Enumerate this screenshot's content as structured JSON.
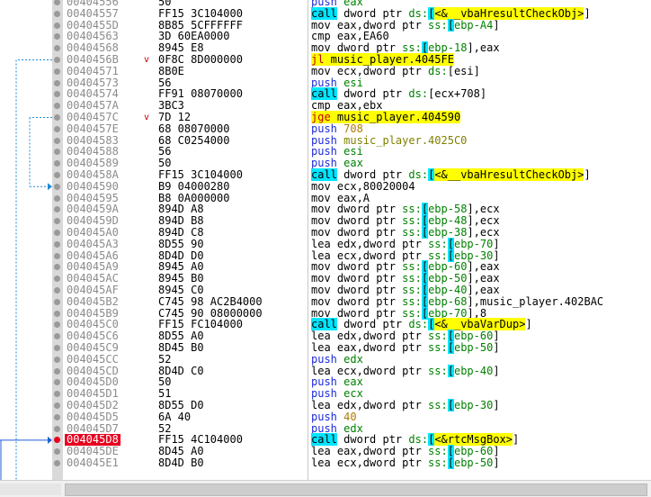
{
  "rows": [
    {
      "addr": "00404556",
      "bytes": "50",
      "marker": "",
      "parts": [
        [
          "push",
          "mn-push"
        ],
        [
          " eax",
          "reg"
        ]
      ]
    },
    {
      "addr": "00404557",
      "bytes": "FF15 3C104000",
      "marker": "",
      "parts": [
        [
          "call",
          "mn-call"
        ],
        [
          " dword ptr ",
          "kw"
        ],
        [
          "ds:",
          "seg"
        ],
        [
          "[",
          "br"
        ],
        [
          "<&__vbaHresultCheckObj>",
          "op-call"
        ],
        [
          "]",
          "kw"
        ]
      ]
    },
    {
      "addr": "0040455D",
      "bytes": "8B85 5CFFFFFF",
      "marker": "",
      "parts": [
        [
          "mov eax,dword ptr ",
          "kw"
        ],
        [
          "ss:",
          "seg"
        ],
        [
          "[",
          "br"
        ],
        [
          "ebp-A4",
          "off"
        ],
        [
          "]",
          "kw"
        ]
      ]
    },
    {
      "addr": "00404563",
      "bytes": "3D 60EA0000",
      "marker": "",
      "parts": [
        [
          "cmp eax,EA60",
          "kw"
        ]
      ]
    },
    {
      "addr": "00404568",
      "bytes": "8945 E8",
      "marker": "",
      "parts": [
        [
          "mov dword ptr ",
          "kw"
        ],
        [
          "ss:",
          "seg"
        ],
        [
          "[",
          "br"
        ],
        [
          "ebp-18",
          "off"
        ],
        [
          "],eax",
          "kw"
        ]
      ]
    },
    {
      "addr": "0040456B",
      "bytes": "0F8C 8D000000",
      "marker": "v",
      "parts": [
        [
          "jl",
          "mn-jmp"
        ],
        [
          " music_player.4045FE",
          "op-jmp"
        ]
      ]
    },
    {
      "addr": "00404571",
      "bytes": "8B0E",
      "marker": "",
      "parts": [
        [
          "mov ecx,dword ptr ",
          "kw"
        ],
        [
          "ds:",
          "seg"
        ],
        [
          "[esi]",
          "kw"
        ]
      ]
    },
    {
      "addr": "00404573",
      "bytes": "56",
      "marker": "",
      "parts": [
        [
          "push",
          "mn-push"
        ],
        [
          " esi",
          "reg"
        ]
      ]
    },
    {
      "addr": "00404574",
      "bytes": "FF91 08070000",
      "marker": "",
      "parts": [
        [
          "call",
          "mn-call"
        ],
        [
          " dword ptr ",
          "kw"
        ],
        [
          "ds:",
          "seg"
        ],
        [
          "[ecx+708]",
          "kw"
        ]
      ]
    },
    {
      "addr": "0040457A",
      "bytes": "3BC3",
      "marker": "",
      "parts": [
        [
          "cmp eax,ebx",
          "kw"
        ]
      ]
    },
    {
      "addr": "0040457C",
      "bytes": "7D 12",
      "marker": "v",
      "parts": [
        [
          "jge",
          "mn-jmp"
        ],
        [
          " music_player.404590",
          "op-jmp"
        ]
      ]
    },
    {
      "addr": "0040457E",
      "bytes": "68 08070000",
      "marker": "",
      "parts": [
        [
          "push",
          "mn-push"
        ],
        [
          " 708",
          "mn-push-num"
        ]
      ]
    },
    {
      "addr": "00404583",
      "bytes": "68 C0254000",
      "marker": "",
      "parts": [
        [
          "push",
          "mn-push"
        ],
        [
          " music_player.4025C0",
          "mn-push-str"
        ]
      ]
    },
    {
      "addr": "00404588",
      "bytes": "56",
      "marker": "",
      "parts": [
        [
          "push",
          "mn-push"
        ],
        [
          " esi",
          "reg"
        ]
      ]
    },
    {
      "addr": "00404589",
      "bytes": "50",
      "marker": "",
      "parts": [
        [
          "push",
          "mn-push"
        ],
        [
          " eax",
          "reg"
        ]
      ]
    },
    {
      "addr": "0040458A",
      "bytes": "FF15 3C104000",
      "marker": "",
      "parts": [
        [
          "call",
          "mn-call"
        ],
        [
          " dword ptr ",
          "kw"
        ],
        [
          "ds:",
          "seg"
        ],
        [
          "[",
          "br"
        ],
        [
          "<&__vbaHresultCheckObj>",
          "op-call"
        ],
        [
          "]",
          "kw"
        ]
      ]
    },
    {
      "addr": "00404590",
      "bytes": "B9 04000280",
      "marker": "",
      "parts": [
        [
          "mov ecx,80020004",
          "kw"
        ]
      ]
    },
    {
      "addr": "00404595",
      "bytes": "B8 0A000000",
      "marker": "",
      "parts": [
        [
          "mov eax,A",
          "kw"
        ]
      ]
    },
    {
      "addr": "0040459A",
      "bytes": "894D A8",
      "marker": "",
      "parts": [
        [
          "mov dword ptr ",
          "kw"
        ],
        [
          "ss:",
          "seg"
        ],
        [
          "[",
          "br"
        ],
        [
          "ebp-58",
          "off"
        ],
        [
          "],ecx",
          "kw"
        ]
      ]
    },
    {
      "addr": "0040459D",
      "bytes": "894D B8",
      "marker": "",
      "parts": [
        [
          "mov dword ptr ",
          "kw"
        ],
        [
          "ss:",
          "seg"
        ],
        [
          "[",
          "br"
        ],
        [
          "ebp-48",
          "off"
        ],
        [
          "],ecx",
          "kw"
        ]
      ]
    },
    {
      "addr": "004045A0",
      "bytes": "894D C8",
      "marker": "",
      "parts": [
        [
          "mov dword ptr ",
          "kw"
        ],
        [
          "ss:",
          "seg"
        ],
        [
          "[",
          "br"
        ],
        [
          "ebp-38",
          "off"
        ],
        [
          "],ecx",
          "kw"
        ]
      ]
    },
    {
      "addr": "004045A3",
      "bytes": "8D55 90",
      "marker": "",
      "parts": [
        [
          "lea edx,dword ptr ",
          "kw"
        ],
        [
          "ss:",
          "seg"
        ],
        [
          "[",
          "br"
        ],
        [
          "ebp-70",
          "off"
        ],
        [
          "]",
          "kw"
        ]
      ]
    },
    {
      "addr": "004045A6",
      "bytes": "8D4D D0",
      "marker": "",
      "parts": [
        [
          "lea ecx,dword ptr ",
          "kw"
        ],
        [
          "ss:",
          "seg"
        ],
        [
          "[",
          "br"
        ],
        [
          "ebp-30",
          "off"
        ],
        [
          "]",
          "kw"
        ]
      ]
    },
    {
      "addr": "004045A9",
      "bytes": "8945 A0",
      "marker": "",
      "parts": [
        [
          "mov dword ptr ",
          "kw"
        ],
        [
          "ss:",
          "seg"
        ],
        [
          "[",
          "br"
        ],
        [
          "ebp-60",
          "off"
        ],
        [
          "],eax",
          "kw"
        ]
      ]
    },
    {
      "addr": "004045AC",
      "bytes": "8945 B0",
      "marker": "",
      "parts": [
        [
          "mov dword ptr ",
          "kw"
        ],
        [
          "ss:",
          "seg"
        ],
        [
          "[",
          "br"
        ],
        [
          "ebp-50",
          "off"
        ],
        [
          "],eax",
          "kw"
        ]
      ]
    },
    {
      "addr": "004045AF",
      "bytes": "8945 C0",
      "marker": "",
      "parts": [
        [
          "mov dword ptr ",
          "kw"
        ],
        [
          "ss:",
          "seg"
        ],
        [
          "[",
          "br"
        ],
        [
          "ebp-40",
          "off"
        ],
        [
          "],eax",
          "kw"
        ]
      ]
    },
    {
      "addr": "004045B2",
      "bytes": "C745 98 AC2B4000",
      "marker": "",
      "parts": [
        [
          "mov dword ptr ",
          "kw"
        ],
        [
          "ss:",
          "seg"
        ],
        [
          "[",
          "br"
        ],
        [
          "ebp-68",
          "off"
        ],
        [
          "],music_player.402BAC",
          "kw"
        ]
      ]
    },
    {
      "addr": "004045B9",
      "bytes": "C745 90 08000000",
      "marker": "",
      "parts": [
        [
          "mov dword ptr ",
          "kw"
        ],
        [
          "ss:",
          "seg"
        ],
        [
          "[",
          "br"
        ],
        [
          "ebp-70",
          "off"
        ],
        [
          "],8",
          "kw"
        ]
      ]
    },
    {
      "addr": "004045C0",
      "bytes": "FF15 FC104000",
      "marker": "",
      "parts": [
        [
          "call",
          "mn-call"
        ],
        [
          " dword ptr ",
          "kw"
        ],
        [
          "ds:",
          "seg"
        ],
        [
          "[",
          "br"
        ],
        [
          "<&__vbaVarDup>",
          "op-call"
        ],
        [
          "]",
          "kw"
        ]
      ]
    },
    {
      "addr": "004045C6",
      "bytes": "8D55 A0",
      "marker": "",
      "parts": [
        [
          "lea edx,dword ptr ",
          "kw"
        ],
        [
          "ss:",
          "seg"
        ],
        [
          "[",
          "br"
        ],
        [
          "ebp-60",
          "off"
        ],
        [
          "]",
          "kw"
        ]
      ]
    },
    {
      "addr": "004045C9",
      "bytes": "8D45 B0",
      "marker": "",
      "parts": [
        [
          "lea eax,dword ptr ",
          "kw"
        ],
        [
          "ss:",
          "seg"
        ],
        [
          "[",
          "br"
        ],
        [
          "ebp-50",
          "off"
        ],
        [
          "]",
          "kw"
        ]
      ]
    },
    {
      "addr": "004045CC",
      "bytes": "52",
      "marker": "",
      "parts": [
        [
          "push",
          "mn-push"
        ],
        [
          " edx",
          "reg"
        ]
      ]
    },
    {
      "addr": "004045CD",
      "bytes": "8D4D C0",
      "marker": "",
      "parts": [
        [
          "lea ecx,dword ptr ",
          "kw"
        ],
        [
          "ss:",
          "seg"
        ],
        [
          "[",
          "br"
        ],
        [
          "ebp-40",
          "off"
        ],
        [
          "]",
          "kw"
        ]
      ]
    },
    {
      "addr": "004045D0",
      "bytes": "50",
      "marker": "",
      "parts": [
        [
          "push",
          "mn-push"
        ],
        [
          " eax",
          "reg"
        ]
      ]
    },
    {
      "addr": "004045D1",
      "bytes": "51",
      "marker": "",
      "parts": [
        [
          "push",
          "mn-push"
        ],
        [
          " ecx",
          "reg"
        ]
      ]
    },
    {
      "addr": "004045D2",
      "bytes": "8D55 D0",
      "marker": "",
      "parts": [
        [
          "lea edx,dword ptr ",
          "kw"
        ],
        [
          "ss:",
          "seg"
        ],
        [
          "[",
          "br"
        ],
        [
          "ebp-30",
          "off"
        ],
        [
          "]",
          "kw"
        ]
      ]
    },
    {
      "addr": "004045D5",
      "bytes": "6A 40",
      "marker": "",
      "parts": [
        [
          "push",
          "mn-push"
        ],
        [
          " 40",
          "mn-push-num"
        ]
      ]
    },
    {
      "addr": "004045D7",
      "bytes": "52",
      "marker": "",
      "parts": [
        [
          "push",
          "mn-push"
        ],
        [
          " edx",
          "reg"
        ]
      ]
    },
    {
      "addr": "004045D8",
      "bytes": "FF15 4C104000",
      "marker": "",
      "current": true,
      "parts": [
        [
          "call",
          "mn-call"
        ],
        [
          " dword ptr ",
          "kw"
        ],
        [
          "ds:",
          "seg"
        ],
        [
          "[",
          "br"
        ],
        [
          "<&rtcMsgBox>",
          "op-call"
        ],
        [
          "]",
          "kw"
        ]
      ]
    },
    {
      "addr": "004045DE",
      "bytes": "8D45 A0",
      "marker": "",
      "parts": [
        [
          "lea eax,dword ptr ",
          "kw"
        ],
        [
          "ss:",
          "seg"
        ],
        [
          "[",
          "br"
        ],
        [
          "ebp-60",
          "off"
        ],
        [
          "]",
          "kw"
        ]
      ]
    },
    {
      "addr": "004045E1",
      "bytes": "8D4D B0",
      "marker": "",
      "parts": [
        [
          "lea ecx,dword ptr ",
          "kw"
        ],
        [
          "ss:",
          "seg"
        ],
        [
          "[",
          "br"
        ],
        [
          "ebp-50",
          "off"
        ],
        [
          "]",
          "kw"
        ]
      ]
    }
  ]
}
